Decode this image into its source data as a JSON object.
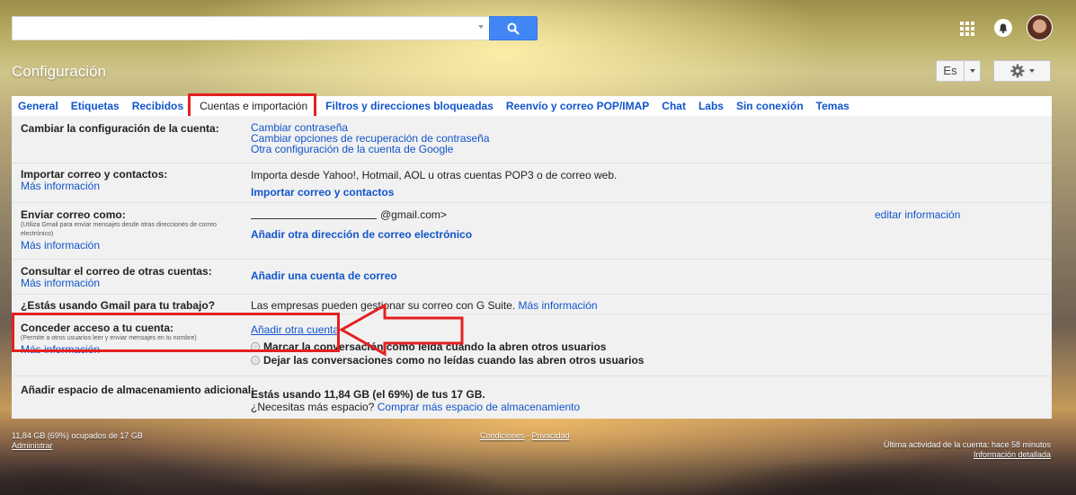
{
  "search": {
    "placeholder": ""
  },
  "header": {
    "title": "Configuración",
    "language_button": "Es",
    "accent_color": "#4285f4"
  },
  "tabs": [
    {
      "label": "General"
    },
    {
      "label": "Etiquetas"
    },
    {
      "label": "Recibidos"
    },
    {
      "label": "Cuentas e importación",
      "active": true
    },
    {
      "label": "Filtros y direcciones bloqueadas"
    },
    {
      "label": "Reenvío y correo POP/IMAP"
    },
    {
      "label": "Chat"
    },
    {
      "label": "Labs"
    },
    {
      "label": "Sin conexión"
    },
    {
      "label": "Temas"
    }
  ],
  "rows": {
    "change_account": {
      "label": "Cambiar la configuración de la cuenta:",
      "links": [
        "Cambiar contraseña",
        "Cambiar opciones de recuperación de contraseña",
        "Otra configuración de la cuenta de Google"
      ]
    },
    "import": {
      "label": "Importar correo y contactos:",
      "more_info": "Más información",
      "description": "Importa desde Yahoo!, Hotmail, AOL u otras cuentas POP3 o de correo web.",
      "action": "Importar correo y contactos"
    },
    "send_as": {
      "label": "Enviar correo como:",
      "note": "(Utiliza Gmail para enviar mensajes desde otras direcciones de correo electrónico)",
      "more_info": "Más información",
      "email": "@gmail.com>",
      "edit": "editar información",
      "action": "Añadir otra dirección de correo electrónico"
    },
    "check_other": {
      "label": "Consultar el correo de otras cuentas:",
      "more_info": "Más información",
      "action": "Añadir una cuenta de correo"
    },
    "work": {
      "label": "¿Estás usando Gmail para tu trabajo?",
      "description": "Las empresas pueden gestionar su correo con G Suite.",
      "more_info": "Más información"
    },
    "grant_access": {
      "label": "Conceder acceso a tu cuenta:",
      "note": "(Permite a otros usuarios leer y enviar mensajes en tu nombre)",
      "more_info": "Más información",
      "action": "Añadir otra cuenta",
      "option_read": "Marcar la conversación como leída cuando la abren otros usuarios",
      "option_unread": "Dejar las conversaciones como no leídas cuando las abren otros usuarios"
    },
    "storage": {
      "label": "Añadir espacio de almacenamiento adicional:",
      "usage": "Estás usando 11,84 GB (el 69%) de tus 17 GB.",
      "question": "¿Necesitas más espacio?",
      "action": "Comprar más espacio de almacenamiento"
    }
  },
  "footer": {
    "storage": "11,84 GB (69%) ocupados de 17 GB",
    "manage": "Administrar",
    "terms": "Condiciones",
    "separator": " - ",
    "privacy": "Privacidad",
    "last_activity": "Última actividad de la cuenta: hace 58 minutos",
    "details": "Información detallada"
  },
  "annotation_color": "#e32020"
}
